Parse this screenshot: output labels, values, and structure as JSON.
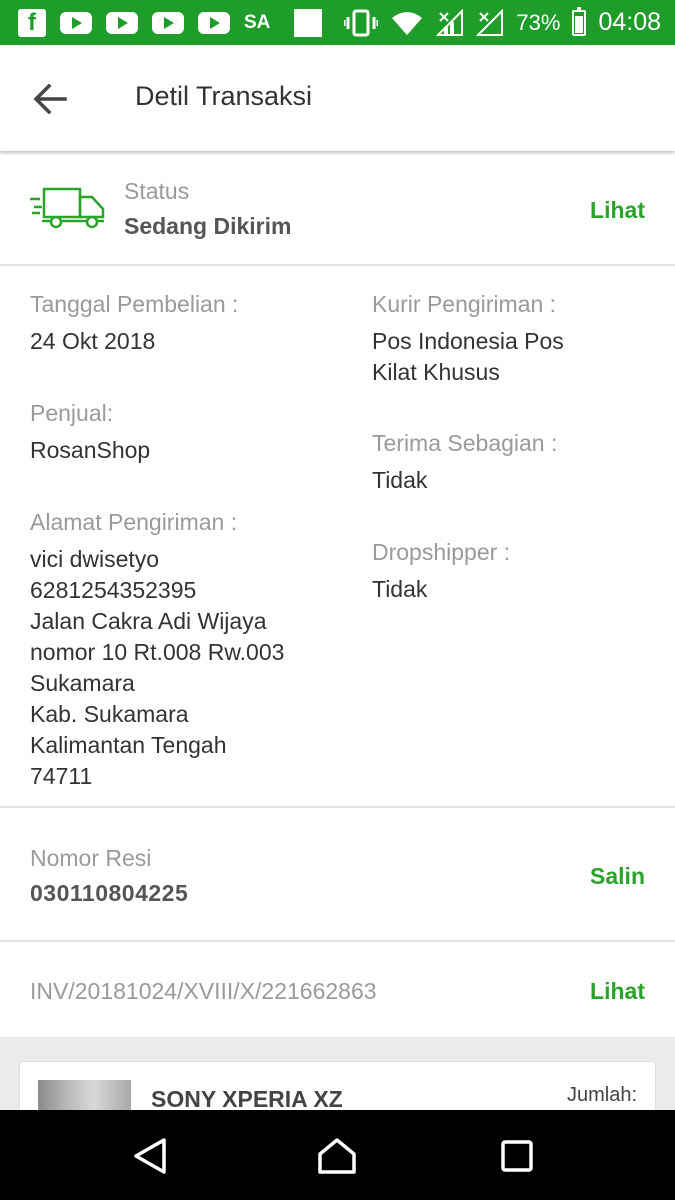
{
  "status_bar": {
    "facebook_letter": "f",
    "carrier": "SA",
    "battery": "73%",
    "time": "04:08"
  },
  "header": {
    "title": "Detil Transaksi"
  },
  "status": {
    "label": "Status",
    "value": "Sedang Dikirim",
    "action": "Lihat"
  },
  "details": {
    "purchase_date": {
      "label": "Tanggal Pembelian :",
      "value": "24 Okt 2018"
    },
    "seller": {
      "label": "Penjual:",
      "value": "RosanShop"
    },
    "address": {
      "label": "Alamat Pengiriman :",
      "lines": [
        "vici dwisetyo",
        "6281254352395",
        "Jalan Cakra Adi Wijaya",
        "nomor 10 Rt.008 Rw.003",
        "Sukamara",
        "Kab. Sukamara",
        "Kalimantan Tengah",
        "74711"
      ]
    },
    "courier": {
      "label": "Kurir Pengiriman :",
      "lines": [
        "Pos Indonesia Pos",
        "Kilat Khusus"
      ]
    },
    "partial": {
      "label": "Terima Sebagian :",
      "value": "Tidak"
    },
    "dropshipper": {
      "label": "Dropshipper :",
      "value": "Tidak"
    }
  },
  "resi": {
    "label": "Nomor Resi",
    "value": "030110804225",
    "action": "Salin"
  },
  "invoice": {
    "number": "INV/20181024/XVIII/X/221662863",
    "action": "Lihat"
  },
  "product": {
    "name": "SONY XPERIA XZ",
    "qty_label": "Jumlah:"
  },
  "colors": {
    "status_bar": "#1f9d2a",
    "accent_green": "#2ba32b",
    "nav_bar": "#000000"
  },
  "icons": {
    "back": "arrow-left-icon",
    "status": "delivery-truck-icon",
    "nav_back": "triangle-back-icon",
    "nav_home": "home-icon",
    "nav_recent": "square-recents-icon"
  }
}
